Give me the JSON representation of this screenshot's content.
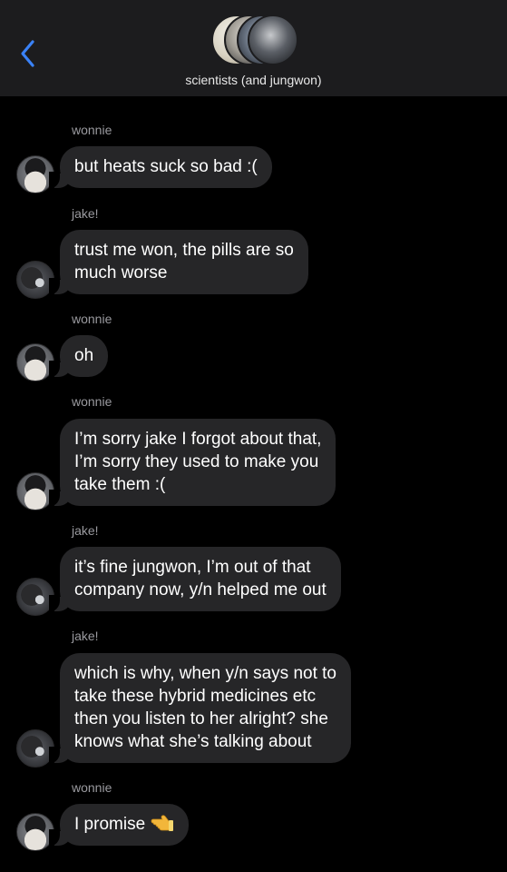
{
  "header": {
    "group_name": "scientists (and jungwon)"
  },
  "messages": [
    {
      "sender": "wonnie",
      "text": "but heats suck so bad :("
    },
    {
      "sender": "jake!",
      "text": "trust me won, the pills are so\nmuch worse"
    },
    {
      "sender": "wonnie",
      "text": "oh"
    },
    {
      "sender": "wonnie",
      "text": "I’m sorry jake I forgot about that,\nI’m sorry they used to make you\ntake them :("
    },
    {
      "sender": "jake!",
      "text": "it’s fine jungwon, I’m out of that\ncompany now, y/n helped me out"
    },
    {
      "sender": "jake!",
      "text": "which is why, when y/n says not to\ntake these hybrid medicines etc\nthen you listen to her alright? she\nknows what she’s talking about"
    },
    {
      "sender": "wonnie",
      "text": "I promise",
      "emoji": "pointing-hand-emoji"
    }
  ],
  "colors": {
    "header_bg": "#1c1c1e",
    "bubble_bg": "#262628",
    "back_accent": "#3a82f7",
    "sender_label": "#9a9a9f"
  }
}
